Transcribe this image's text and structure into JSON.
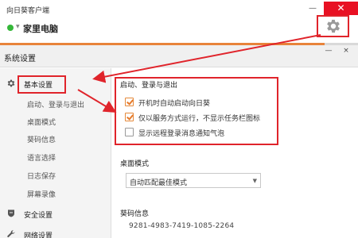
{
  "client": {
    "title": "向日葵客户端",
    "device_name": "家里电脑",
    "status_color": "#35b739",
    "minimize_label": "—",
    "close_label": "✕",
    "settings_icon": "gear-icon"
  },
  "settings": {
    "title": "系统设置",
    "minimize_label": "—",
    "close_label": "×",
    "sidebar": [
      {
        "label": "基本设置",
        "icon": "gear-icon",
        "type": "main",
        "active": true
      },
      {
        "label": "启动、登录与退出",
        "type": "sub"
      },
      {
        "label": "桌面模式",
        "type": "sub"
      },
      {
        "label": "葵码信息",
        "type": "sub"
      },
      {
        "label": "语言选择",
        "type": "sub"
      },
      {
        "label": "日志保存",
        "type": "sub"
      },
      {
        "label": "屏幕录像",
        "type": "sub"
      },
      {
        "label": "安全设置",
        "icon": "shield-icon",
        "type": "main"
      },
      {
        "label": "网络设置",
        "icon": "wrench-icon",
        "type": "main"
      }
    ],
    "startup_section": {
      "title": "启动、登录与退出",
      "options": [
        {
          "label": "开机时自动启动向日葵",
          "checked": true
        },
        {
          "label": "仅以服务方式运行，不显示任务栏图标",
          "checked": true
        },
        {
          "label": "显示远程登录消息通知气泡",
          "checked": false
        }
      ]
    },
    "desktop_section": {
      "title": "桌面模式",
      "selected": "自动匹配最佳模式"
    },
    "code_section": {
      "title": "葵码信息",
      "value": "9281-4983-7419-1085-2264"
    },
    "annotation_color": "#e0242b"
  }
}
